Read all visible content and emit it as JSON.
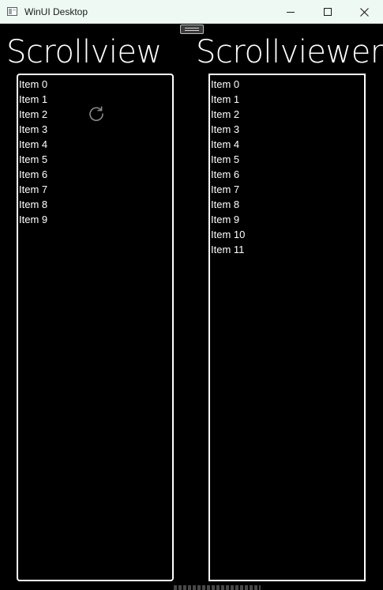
{
  "window": {
    "title": "WinUI Desktop",
    "icons": {
      "app": "app-window-icon",
      "minimize": "minimize-icon",
      "maximize": "maximize-icon",
      "close": "close-icon",
      "refresh": "refresh-icon",
      "drag": "drag-handle-icon"
    }
  },
  "left": {
    "heading": "Scrollview",
    "items": [
      "Item 0",
      "Item 1",
      "Item 2",
      "Item 3",
      "Item 4",
      "Item 5",
      "Item 6",
      "Item 7",
      "Item 8",
      "Item 9"
    ]
  },
  "right": {
    "heading": "Scrollviewer",
    "items": [
      "Item 0",
      "Item 1",
      "Item 2",
      "Item 3",
      "Item 4",
      "Item 5",
      "Item 6",
      "Item 7",
      "Item 8",
      "Item 9",
      "Item 10",
      "Item 11"
    ]
  },
  "colors": {
    "background": "#000000",
    "text": "#ffffff",
    "titlebar": "#eef9f3",
    "border": "#ffffff"
  }
}
